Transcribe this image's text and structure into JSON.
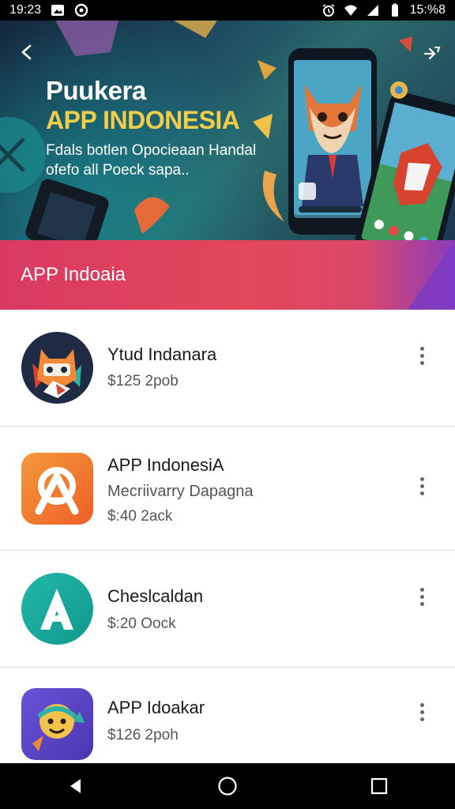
{
  "status_bar": {
    "time_left": "19:23",
    "time_right": "15:%8",
    "icons": [
      "image-notification-icon",
      "sync-icon",
      "alarm-icon",
      "wifi-icon",
      "signal-icon",
      "battery-icon"
    ]
  },
  "banner": {
    "title_line1": "Puukera",
    "title_line2": "APP INDONESIA",
    "subtitle": "Fdals botlen Opocieaan Handal ofefo all Poeck sapa..",
    "colors": {
      "title_accent": "#f2cd4a",
      "background": "#1f4f63"
    }
  },
  "section": {
    "title": "APP Indoaia",
    "color": "#e2475a"
  },
  "apps": [
    {
      "name": "Ytud Indanara",
      "description": "",
      "price": "$125 2pob",
      "icon": "fox-app-icon",
      "icon_color": "#1f2a44"
    },
    {
      "name": "APP IndonesiA",
      "description": "Mecriivarry Dapagna",
      "price": "$:40 2ack",
      "icon": "a-letter-orange-icon",
      "icon_color": "#f07a2e"
    },
    {
      "name": "Cheslcaldan",
      "description": "",
      "price": "$:20 Oock",
      "icon": "a-letter-teal-icon",
      "icon_color": "#1aa99a"
    },
    {
      "name": "APP Idoakar",
      "description": "",
      "price": "$126 2poh",
      "icon": "smiley-app-icon",
      "icon_color": "#5a45c8"
    }
  ],
  "nav": {
    "back": "back-icon",
    "home": "home-icon",
    "recents": "recents-icon"
  }
}
